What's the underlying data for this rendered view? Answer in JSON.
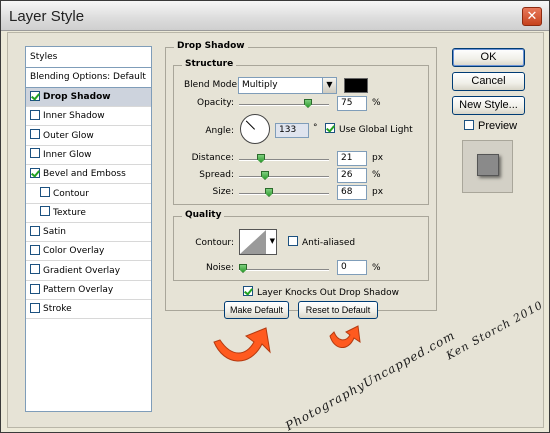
{
  "window": {
    "title": "Layer Style",
    "close_glyph": "✕"
  },
  "sidebar": {
    "header": "Styles",
    "blending": "Blending Options: Default",
    "items": [
      {
        "label": "Drop Shadow",
        "checked": true,
        "selected": true,
        "indent": false
      },
      {
        "label": "Inner Shadow",
        "checked": false,
        "selected": false,
        "indent": false
      },
      {
        "label": "Outer Glow",
        "checked": false,
        "selected": false,
        "indent": false
      },
      {
        "label": "Inner Glow",
        "checked": false,
        "selected": false,
        "indent": false
      },
      {
        "label": "Bevel and Emboss",
        "checked": true,
        "selected": false,
        "indent": false
      },
      {
        "label": "Contour",
        "checked": false,
        "selected": false,
        "indent": true
      },
      {
        "label": "Texture",
        "checked": false,
        "selected": false,
        "indent": true
      },
      {
        "label": "Satin",
        "checked": false,
        "selected": false,
        "indent": false
      },
      {
        "label": "Color Overlay",
        "checked": false,
        "selected": false,
        "indent": false
      },
      {
        "label": "Gradient Overlay",
        "checked": false,
        "selected": false,
        "indent": false
      },
      {
        "label": "Pattern Overlay",
        "checked": false,
        "selected": false,
        "indent": false
      },
      {
        "label": "Stroke",
        "checked": false,
        "selected": false,
        "indent": false
      }
    ]
  },
  "drop_shadow": {
    "title": "Drop Shadow",
    "structure": {
      "title": "Structure",
      "blend_mode_label": "Blend Mode:",
      "blend_mode_value": "Multiply",
      "shadow_color": "#000000",
      "opacity_label": "Opacity:",
      "opacity_value": "75",
      "opacity_unit": "%",
      "angle_label": "Angle:",
      "angle_value": "133",
      "angle_unit": "°",
      "use_global_light_label": "Use Global Light",
      "use_global_light_checked": true,
      "distance_label": "Distance:",
      "distance_value": "21",
      "distance_unit": "px",
      "spread_label": "Spread:",
      "spread_value": "26",
      "spread_unit": "%",
      "size_label": "Size:",
      "size_value": "68",
      "size_unit": "px"
    },
    "quality": {
      "title": "Quality",
      "contour_label": "Contour:",
      "anti_aliased_label": "Anti-aliased",
      "anti_aliased_checked": false,
      "noise_label": "Noise:",
      "noise_value": "0",
      "noise_unit": "%"
    },
    "layer_knocks_out_label": "Layer Knocks Out Drop Shadow",
    "layer_knocks_out_checked": true,
    "make_default_label": "Make Default",
    "reset_default_label": "Reset to Default"
  },
  "buttons": {
    "ok": "OK",
    "cancel": "Cancel",
    "new_style": "New Style...",
    "preview_label": "Preview",
    "preview_checked": false
  },
  "annotations": {
    "watermark_1": "PhotographyUncapped.com",
    "watermark_2": "Ken Storch 2010",
    "arrow_color": "#ff5a1f"
  }
}
